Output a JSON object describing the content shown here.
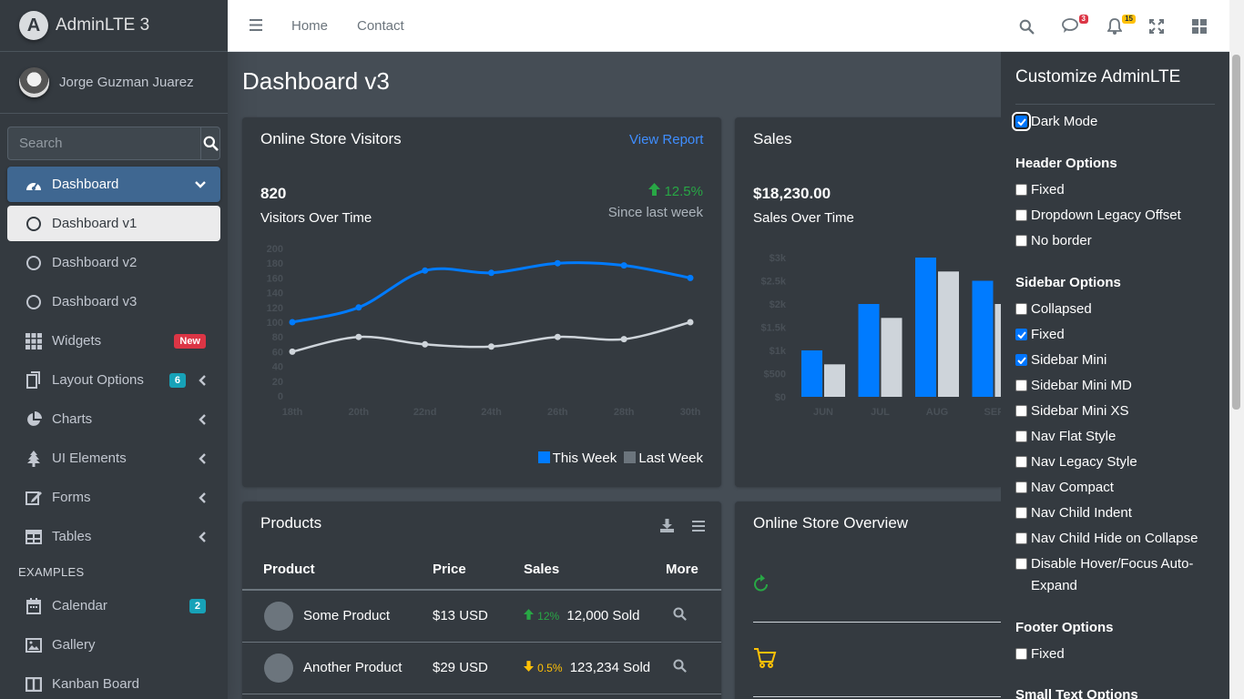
{
  "brand": {
    "name": "AdminLTE 3"
  },
  "user": {
    "name": "Jorge Guzman Juarez"
  },
  "search": {
    "placeholder": "Search"
  },
  "sidebar": {
    "items": [
      {
        "label": "Dashboard"
      },
      {
        "label": "Dashboard v1"
      },
      {
        "label": "Dashboard v2"
      },
      {
        "label": "Dashboard v3"
      },
      {
        "label": "Widgets",
        "badge": "New"
      },
      {
        "label": "Layout Options",
        "badge": "6"
      },
      {
        "label": "Charts"
      },
      {
        "label": "UI Elements"
      },
      {
        "label": "Forms"
      },
      {
        "label": "Tables"
      }
    ],
    "header": "EXAMPLES",
    "examples": [
      {
        "label": "Calendar",
        "badge": "2"
      },
      {
        "label": "Gallery"
      },
      {
        "label": "Kanban Board"
      }
    ]
  },
  "navbar": {
    "links": [
      "Home",
      "Contact"
    ],
    "messages_count": "3",
    "notifications_count": "15"
  },
  "page": {
    "title": "Dashboard v3"
  },
  "visitors_card": {
    "title": "Online Store Visitors",
    "link": "View Report",
    "count": "820",
    "subtitle": "Visitors Over Time",
    "change": "12.5%",
    "since": "Since last week",
    "legend": [
      "This Week",
      "Last Week"
    ]
  },
  "sales_card": {
    "title": "Sales",
    "amount": "$18,230.00",
    "subtitle": "Sales Over Time"
  },
  "products_card": {
    "title": "Products",
    "columns": [
      "Product",
      "Price",
      "Sales",
      "More"
    ],
    "rows": [
      {
        "name": "Some Product",
        "price": "$13 USD",
        "change": "12%",
        "sold": "12,000 Sold"
      },
      {
        "name": "Another Product",
        "price": "$29 USD",
        "change": "0.5%",
        "sold": "123,234 Sold"
      }
    ]
  },
  "overview_card": {
    "title": "Online Store Overview"
  },
  "customize": {
    "title": "Customize AdminLTE",
    "dark_mode": {
      "label": "Dark Mode",
      "checked": true
    },
    "header_heading": "Header Options",
    "header_options": [
      {
        "label": "Fixed",
        "checked": false
      },
      {
        "label": "Dropdown Legacy Offset",
        "checked": false
      },
      {
        "label": "No border",
        "checked": false
      }
    ],
    "sidebar_heading": "Sidebar Options",
    "sidebar_options": [
      {
        "label": "Collapsed",
        "checked": false
      },
      {
        "label": "Fixed",
        "checked": true
      },
      {
        "label": "Sidebar Mini",
        "checked": true
      },
      {
        "label": "Sidebar Mini MD",
        "checked": false
      },
      {
        "label": "Sidebar Mini XS",
        "checked": false
      },
      {
        "label": "Nav Flat Style",
        "checked": false
      },
      {
        "label": "Nav Legacy Style",
        "checked": false
      },
      {
        "label": "Nav Compact",
        "checked": false
      },
      {
        "label": "Nav Child Indent",
        "checked": false
      },
      {
        "label": "Nav Child Hide on Collapse",
        "checked": false
      },
      {
        "label": "Disable Hover/Focus Auto-Expand",
        "checked": false
      }
    ],
    "footer_heading": "Footer Options",
    "footer_options": [
      {
        "label": "Fixed",
        "checked": false
      }
    ],
    "small_text_heading": "Small Text Options"
  },
  "colors": {
    "this_week": "#007bff",
    "last_week": "#ced4da",
    "success": "#28a745",
    "warning": "#ffc107"
  },
  "chart_data": [
    {
      "type": "line",
      "x": [
        "18th",
        "20th",
        "22nd",
        "24th",
        "26th",
        "28th",
        "30th"
      ],
      "yticks": [
        0,
        20,
        40,
        60,
        80,
        100,
        120,
        140,
        160,
        180,
        200
      ],
      "ylim": [
        0,
        200
      ],
      "series": [
        {
          "name": "This Week",
          "values": [
            100,
            120,
            170,
            167,
            180,
            177,
            160
          ]
        },
        {
          "name": "Last Week",
          "values": [
            60,
            80,
            70,
            67,
            80,
            77,
            100
          ]
        }
      ],
      "legend": "bottom-right"
    },
    {
      "type": "bar",
      "categories": [
        "JUN",
        "JUL",
        "AUG",
        "SEP"
      ],
      "yticks": [
        "$0",
        "$500",
        "$1k",
        "$1.5k",
        "$2k",
        "$2.5k",
        "$3k"
      ],
      "ylim": [
        0,
        3000
      ],
      "series": [
        {
          "name": "This Week",
          "values": [
            1000,
            2000,
            3000,
            2500
          ]
        },
        {
          "name": "Last Week",
          "values": [
            700,
            1700,
            2700,
            2000
          ]
        }
      ]
    }
  ]
}
